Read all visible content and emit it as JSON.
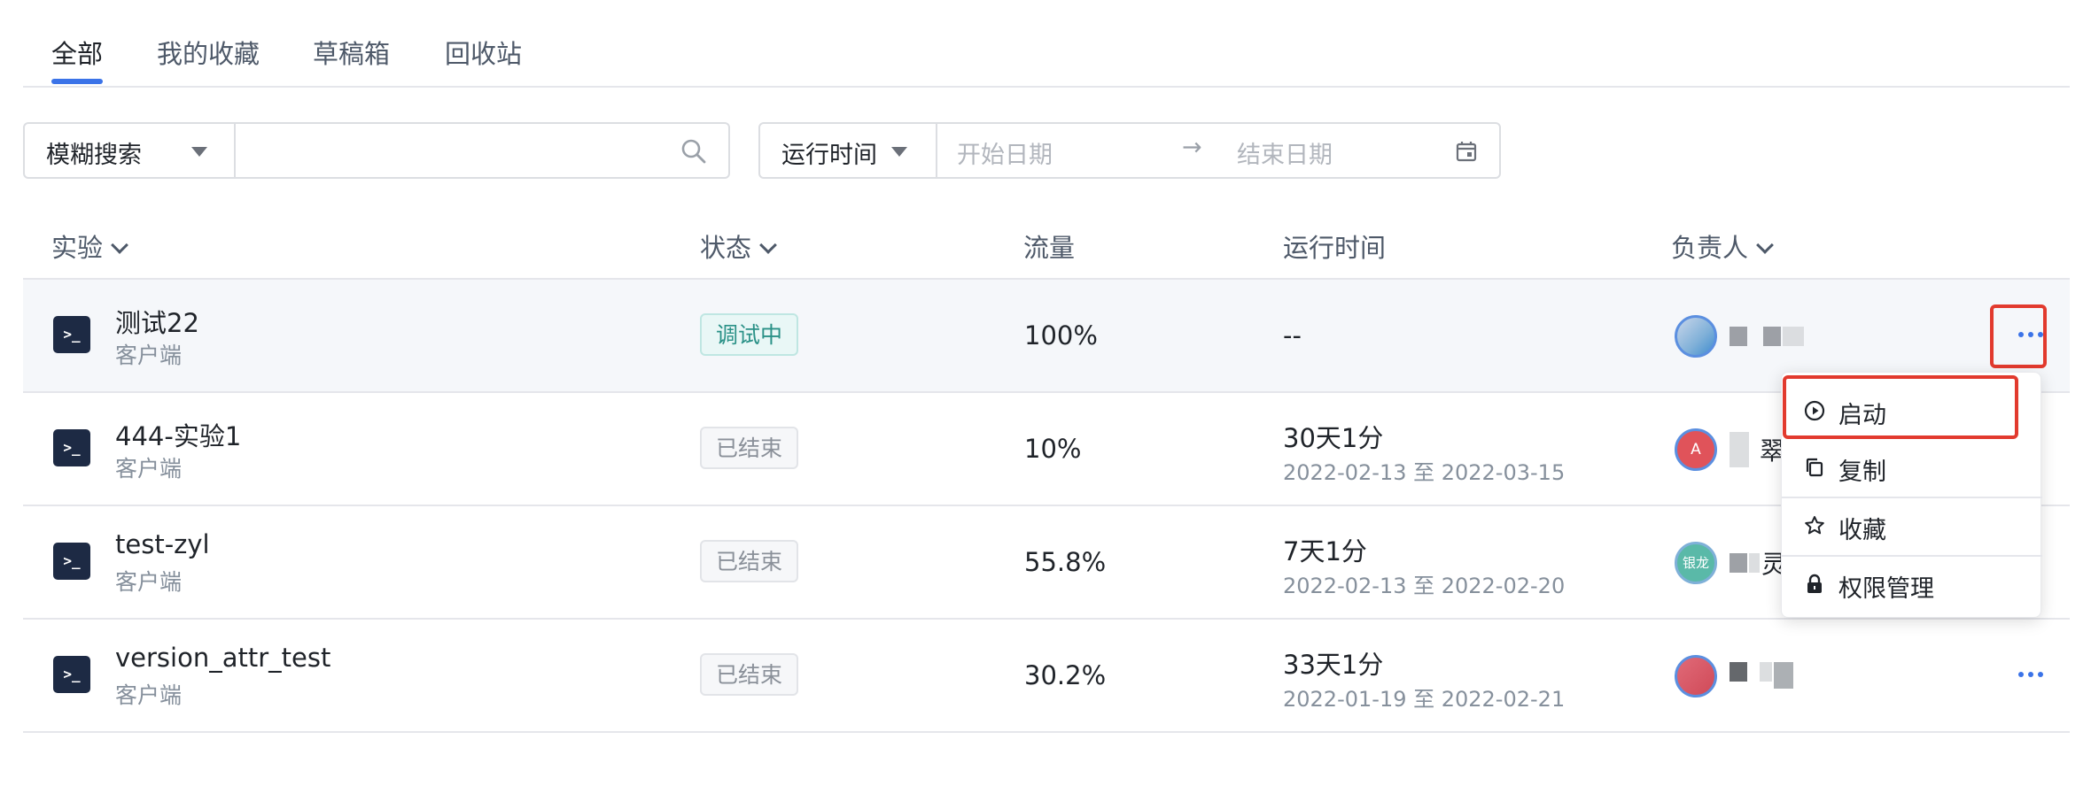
{
  "tabs": [
    {
      "label": "全部",
      "active": true
    },
    {
      "label": "我的收藏",
      "active": false
    },
    {
      "label": "草稿箱",
      "active": false
    },
    {
      "label": "回收站",
      "active": false
    }
  ],
  "filters": {
    "search_mode": "模糊搜索",
    "search_value": "",
    "time_field": "运行时间",
    "start_placeholder": "开始日期",
    "arrow": "→",
    "end_placeholder": "结束日期"
  },
  "table": {
    "headers": [
      "实验",
      "状态",
      "流量",
      "运行时间",
      "负责人"
    ],
    "rows": [
      {
        "name": "测试22",
        "platform": "客户端",
        "status": "调试中",
        "traffic": "100%",
        "run_time": "--",
        "range": "",
        "owner_initial": ""
      },
      {
        "name": "444-实验1",
        "platform": "客户端",
        "status": "已结束",
        "traffic": "10%",
        "run_time": "30天1分",
        "range": "2022-02-13 至 2022-03-15",
        "owner_initial": "A",
        "owner_visible": "翠"
      },
      {
        "name": "test-zyl",
        "platform": "客户端",
        "status": "已结束",
        "traffic": "55.8%",
        "run_time": "7天1分",
        "range": "2022-02-13 至 2022-02-20",
        "owner_initial": "银龙",
        "owner_visible": "灵"
      },
      {
        "name": "version_attr_test",
        "platform": "客户端",
        "status": "已结束",
        "traffic": "30.2%",
        "run_time": "33天1分",
        "range": "2022-01-19 至 2022-02-21",
        "owner_initial": ""
      }
    ]
  },
  "icons": {
    "experiment": ">_",
    "more": "···"
  },
  "menu": {
    "items": [
      {
        "label": "启动",
        "icon": "play-circle-icon"
      },
      {
        "label": "复制",
        "icon": "copy-icon"
      },
      {
        "label": "收藏",
        "icon": "star-icon"
      },
      {
        "label": "权限管理",
        "icon": "lock-icon"
      }
    ]
  },
  "colors": {
    "accent": "#3b73e8",
    "highlight_outline": "#e23a2e",
    "debug_text": "#2a9187",
    "ended_text": "#8a9099"
  }
}
